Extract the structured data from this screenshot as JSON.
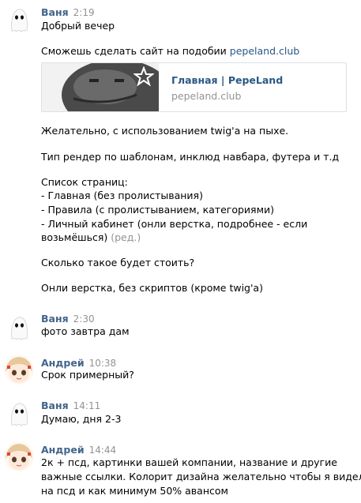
{
  "messages": [
    {
      "author": "Ваня",
      "time": "2:19",
      "lines": [
        "Добрый вечер",
        "Сможешь сделать сайт на подобии ",
        "Желательно, с использованием twig'а на пыхе.",
        "Тип рендер по шаблонам, инклюд навбара, футера и т.д",
        "Список страниц:",
        "- Главная (без пролистывания)",
        "- Правила (с пролистыванием, категориями)",
        "- Личный кабинет (онли верстка, подробнее - если",
        "возьмёшься) ",
        "Сколько такое будет стоить?",
        "Онли верстка, без скриптов (кроме twig'а)"
      ],
      "link": "pepeland.club",
      "edited": "(ред.)",
      "card": {
        "title": "Главная | PepeLand",
        "domain": "pepeland.club"
      }
    },
    {
      "author": "Ваня",
      "time": "2:30",
      "lines": [
        "фото завтра дам"
      ]
    },
    {
      "author": "Андрей",
      "time": "10:38",
      "lines": [
        "Срок примерный?"
      ]
    },
    {
      "author": "Ваня",
      "time": "14:11",
      "lines": [
        "Думаю, дня 2-3"
      ]
    },
    {
      "author": "Андрей",
      "time": "14:44",
      "lines": [
        "2к + псд, картинки вашей компании, название и другие",
        "важные ссылки. Колорит дизайна желательно чтобы я видел",
        "на псд и как минимум 50% авансом"
      ]
    }
  ],
  "colors": {
    "author": "#42648b",
    "link": "#2a5885",
    "muted": "#939393",
    "card_border": "#dce1e6"
  }
}
